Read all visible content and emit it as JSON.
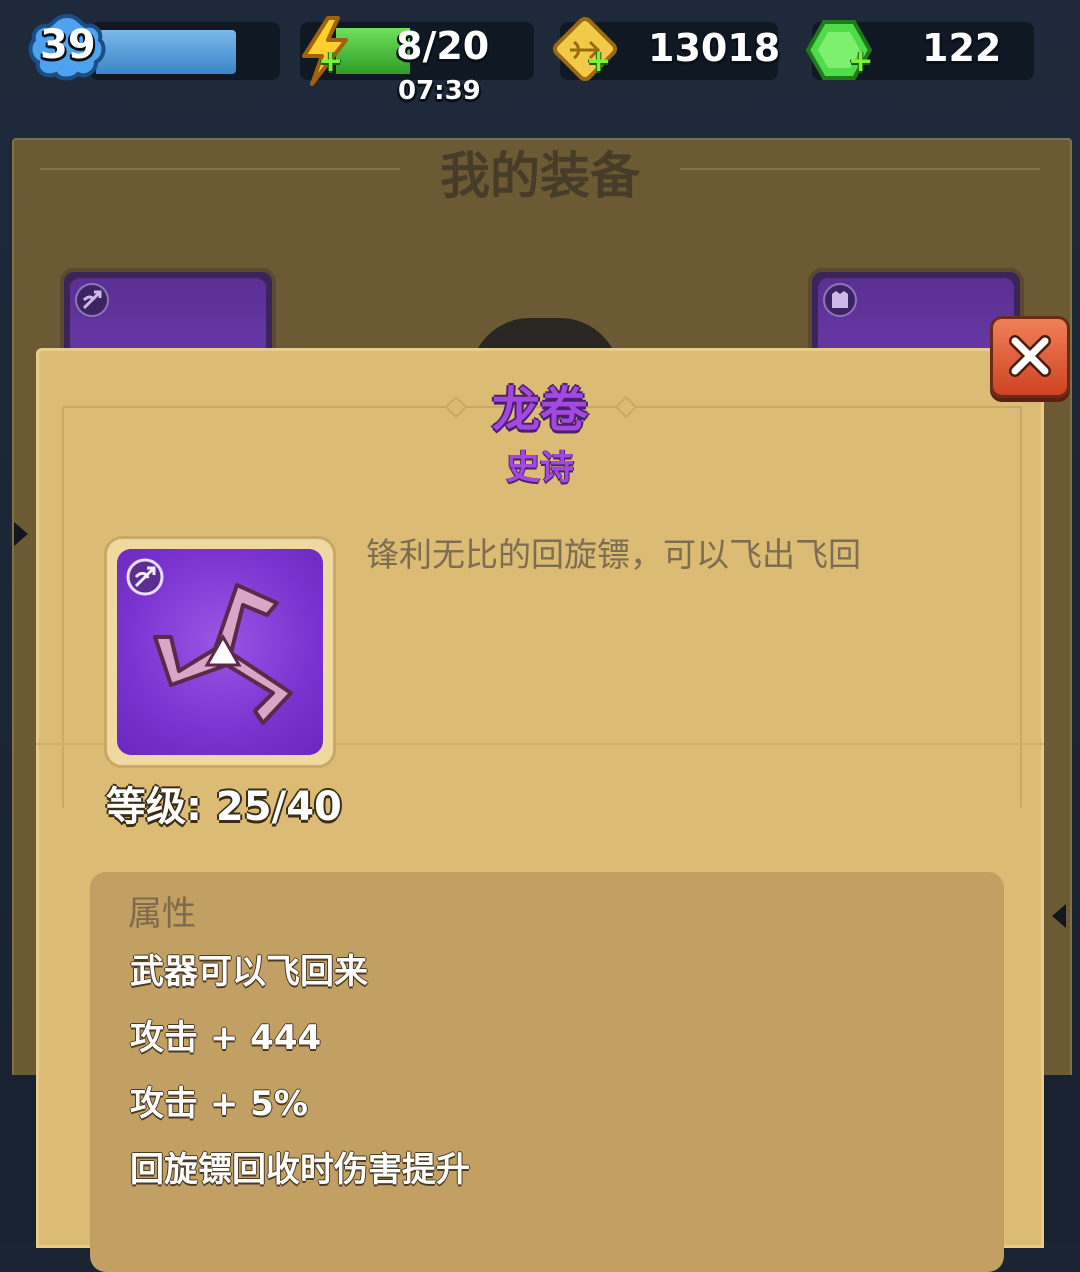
{
  "hud": {
    "level": "39",
    "energy": "8/20",
    "energy_timer": "07:39",
    "gold": "13018",
    "gems": "122",
    "plus_symbol": "+"
  },
  "background": {
    "panel_title": "我的装备"
  },
  "item": {
    "name": "龙卷",
    "rarity": "史诗",
    "description": "锋利无比的回旋镖，可以飞出飞回",
    "level_text": "等级: 25/40",
    "attributes_title": "属性",
    "attributes": [
      "武器可以飞回来",
      "攻击 + 444",
      "攻击 + 5%",
      "回旋镖回收时伤害提升"
    ]
  },
  "colors": {
    "rarity_epic": "#a449e0",
    "panel": "#dcbc74",
    "attr_box": "#c29f62"
  },
  "icons": [
    "weapon-slot-icon",
    "armor-slot-icon",
    "energy-icon",
    "gold-icon",
    "gem-icon",
    "close-icon",
    "boomerang-icon"
  ]
}
